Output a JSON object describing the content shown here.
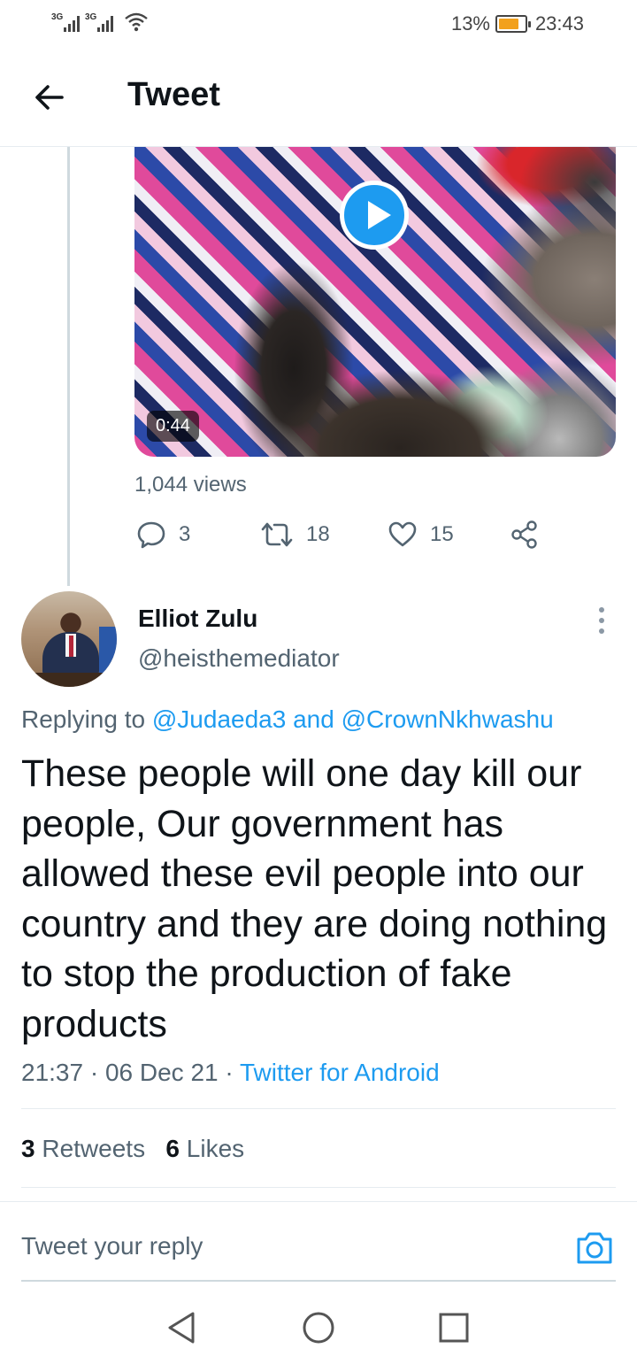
{
  "status_bar": {
    "signal_1": "3G",
    "signal_2": "3G",
    "battery_percent": "13%",
    "time": "23:43"
  },
  "header": {
    "title": "Tweet",
    "back_icon": "arrow-left-icon"
  },
  "quoted_video": {
    "duration": "0:44",
    "views": "1,044 views",
    "play_icon": "play-icon"
  },
  "parent_actions": {
    "replies": "3",
    "retweets": "18",
    "likes": "15",
    "icons": [
      "reply-icon",
      "retweet-icon",
      "like-icon",
      "share-icon"
    ]
  },
  "tweet": {
    "author_name": "Elliot Zulu",
    "author_handle": "@heisthemediator",
    "replying_prefix": "Replying to",
    "replying_user1": "@Judaeda3",
    "replying_and": "and",
    "replying_user2": "@CrownNkhwashu",
    "text": "These people will one day kill our people, Our government has allowed these evil people into our country and they are doing nothing to stop the production of fake products",
    "time": "21:37",
    "date": "06 Dec 21",
    "source": "Twitter for Android",
    "retweets_count": "3",
    "retweets_label": "Retweets",
    "likes_count": "6",
    "likes_label": "Likes"
  },
  "reply_box": {
    "placeholder": "Tweet your reply",
    "camera_icon": "camera-icon"
  },
  "colors": {
    "accent": "#1d9bf0",
    "secondary_text": "#536471",
    "primary_text": "#0f1419",
    "battery_fill": "#f2a11d"
  },
  "system_nav": {
    "icons": [
      "back-triangle-icon",
      "home-circle-icon",
      "recents-square-icon"
    ]
  }
}
